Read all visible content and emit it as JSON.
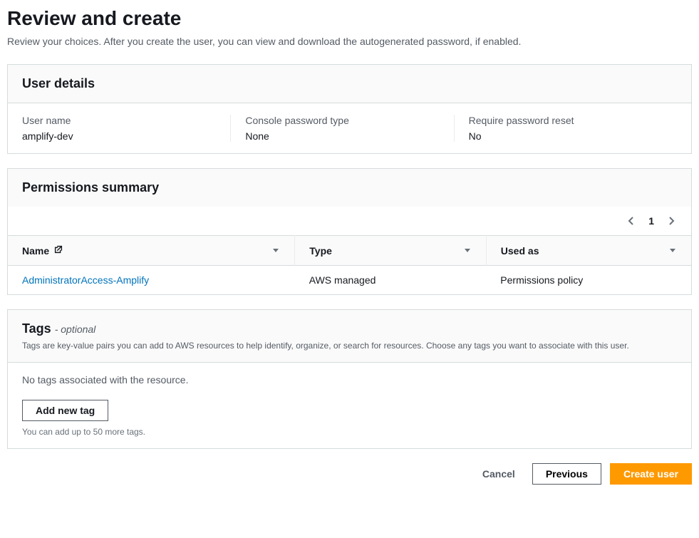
{
  "page": {
    "title": "Review and create",
    "subtitle": "Review your choices. After you create the user, you can view and download the autogenerated password, if enabled."
  },
  "user_details": {
    "heading": "User details",
    "fields": {
      "user_name_label": "User name",
      "user_name_value": "amplify-dev",
      "password_type_label": "Console password type",
      "password_type_value": "None",
      "require_reset_label": "Require password reset",
      "require_reset_value": "No"
    }
  },
  "permissions": {
    "heading": "Permissions summary",
    "pagination": {
      "page": "1"
    },
    "columns": {
      "name": "Name",
      "type": "Type",
      "used_as": "Used as"
    },
    "rows": [
      {
        "name": "AdministratorAccess-Amplify",
        "type": "AWS managed",
        "used_as": "Permissions policy"
      }
    ]
  },
  "tags": {
    "heading": "Tags",
    "optional": "- optional",
    "description": "Tags are key-value pairs you can add to AWS resources to help identify, organize, or search for resources. Choose any tags you want to associate with this user.",
    "empty": "No tags associated with the resource.",
    "add_button": "Add new tag",
    "hint": "You can add up to 50 more tags."
  },
  "footer": {
    "cancel": "Cancel",
    "previous": "Previous",
    "create": "Create user"
  }
}
